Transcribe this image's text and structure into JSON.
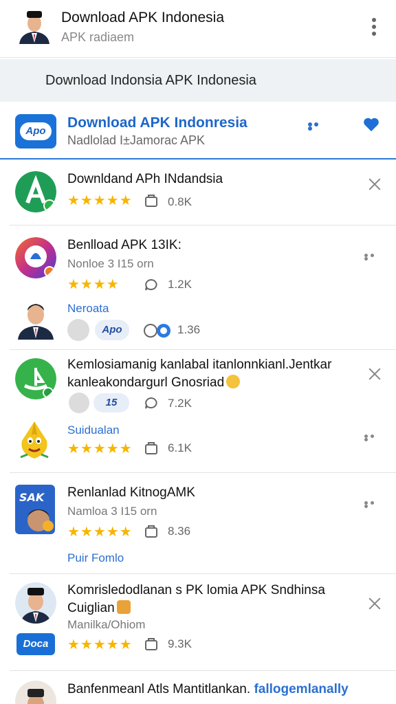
{
  "header": {
    "title": "Download APK Indonesia",
    "subtitle": "APK radiaem"
  },
  "banner": {
    "text": "Download  Indonsia  APK Indonesia"
  },
  "featured": {
    "icon_label": "Apo",
    "title": "Download APK  Indonresia",
    "subtitle": "Nadlolad I±Jamorac APK"
  },
  "items": [
    {
      "name": "Downldand APh INdandsia",
      "stars": "★★★★★",
      "meta": "0.8K"
    },
    {
      "name": "Benlload APK 13IK:",
      "sub": "Nonloe 3 I15 orn",
      "stars": "★★★★",
      "meta": "1.2K",
      "label": "Neroata",
      "chip": "Apo",
      "meta2": "1.36"
    },
    {
      "name_line1": "Kemlosiamanig kanlabal itanlonnkianl.Jentkar",
      "name_line2": "kanleakondargurl Gnosriad",
      "chip": "15",
      "meta": "7.2K",
      "label": "Suidualan",
      "stars": "★★★★★",
      "meta2": "6.1K"
    },
    {
      "name": "Renlanlad KitnogAMK",
      "sub": "Namloa 3 I15 orn",
      "stars": "★★★★★",
      "meta": "8.36",
      "label": "Puir Fomlo"
    },
    {
      "name_line1": "Komrisledodlanan s PK  lomia APK Sndhinsa",
      "name_line2": "Cuiglian",
      "sub": "Manilka/Ohiom",
      "badge": "Doca",
      "stars": "★★★★★",
      "meta": "9.3K"
    },
    {
      "name": "Banfenmeanl Atls Mantitlankan.",
      "link": "fallogemlanally"
    }
  ],
  "colors": {
    "accent_blue": "#1e66c9",
    "star_yellow": "#f7b500",
    "green": "#2db24a"
  }
}
